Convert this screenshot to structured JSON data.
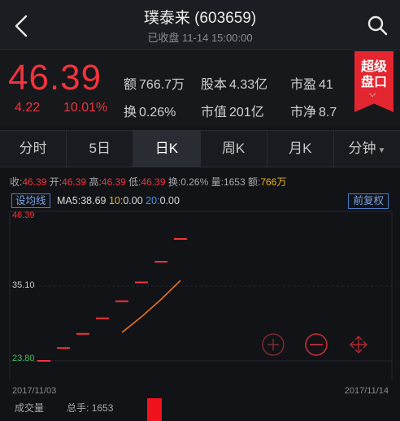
{
  "header": {
    "title": "璞泰来 (603659)",
    "subtitle": "已收盘 11-14 15:00:00"
  },
  "quote": {
    "price": "46.39",
    "change": "4.22",
    "change_pct": "10.01%",
    "amount_label": "额",
    "amount": "766.7万",
    "share_label": "股本",
    "share": "4.33亿",
    "pe_label": "市盈",
    "pe": "41",
    "turnover_label": "换",
    "turnover": "0.26%",
    "mcap_label": "市值",
    "mcap": "201亿",
    "pb_label": "市净",
    "pb": "8.7",
    "badge_line1": "超级",
    "badge_line2": "盘口"
  },
  "tabs": [
    "分时",
    "5日",
    "日K",
    "周K",
    "月K",
    "分钟"
  ],
  "active_tab": 2,
  "info_row": {
    "close_label": "收:",
    "close": "46.39",
    "open_label": "开:",
    "open": "46.39",
    "high_label": "高:",
    "high": "46.39",
    "low_label": "低:",
    "low": "46.39",
    "turn_label": "换:",
    "turn": "0.26%",
    "vol_label": "量:",
    "vol": "1653",
    "amt_label": "额:",
    "amt": "766万"
  },
  "ma_row": {
    "set_button": "设均线",
    "ma5_label": "MA5:",
    "ma5": "38.69",
    "ma10_label": "10:",
    "ma10": "0.00",
    "ma20_label": "20:",
    "ma20": "0.00",
    "adjust_button": "前复权"
  },
  "chart_data": {
    "type": "candlestick",
    "y_labels": [
      "46.39",
      "35.10",
      "23.80"
    ],
    "ylim": [
      23.8,
      46.39
    ],
    "x_start": "2017/11/03",
    "x_end": "2017/11/14",
    "candles": [
      {
        "open": 23.8,
        "close": 23.8,
        "high": 23.8,
        "low": 23.8
      },
      {
        "open": 26.18,
        "close": 26.18,
        "high": 26.18,
        "low": 26.18
      },
      {
        "open": 28.8,
        "close": 28.8,
        "high": 28.8,
        "low": 28.8
      },
      {
        "open": 31.68,
        "close": 31.68,
        "high": 31.68,
        "low": 31.68
      },
      {
        "open": 34.85,
        "close": 34.85,
        "high": 34.85,
        "low": 34.85
      },
      {
        "open": 38.34,
        "close": 38.34,
        "high": 38.34,
        "low": 38.34
      },
      {
        "open": 42.17,
        "close": 42.17,
        "high": 42.17,
        "low": 42.17
      },
      {
        "open": 46.39,
        "close": 46.39,
        "high": 46.39,
        "low": 46.39
      }
    ],
    "ma5": [
      null,
      null,
      null,
      null,
      29.06,
      31.97,
      35.17,
      38.69
    ],
    "colors": {
      "up": "#f2333b",
      "ma5": "#e8731e"
    }
  },
  "volume": {
    "label": "成交量",
    "total_label": "总手:",
    "total": "1653"
  }
}
